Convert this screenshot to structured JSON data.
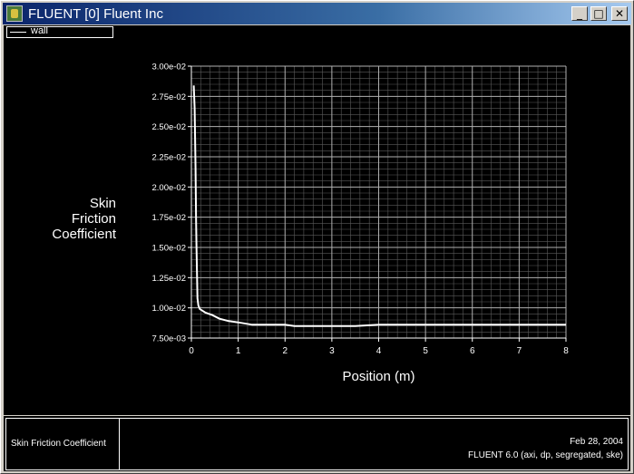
{
  "window": {
    "title": "FLUENT [0] Fluent Inc",
    "buttons": {
      "minimize": "_",
      "maximize": "□",
      "close": "✕"
    }
  },
  "legend": {
    "label": "wall"
  },
  "footer": {
    "plot_name": "Skin Friction Coefficient",
    "date": "Feb 28, 2004",
    "version": "FLUENT 6.0 (axi, dp, segregated, ske)"
  },
  "colors": {
    "background": "#000000",
    "foreground": "#ffffff",
    "grid": "#b0b0b0"
  },
  "chart_data": {
    "type": "line",
    "xlabel": "Position (m)",
    "ylabel": [
      "Skin",
      "Friction",
      "Coefficient"
    ],
    "xlim": [
      0,
      8
    ],
    "ylim": [
      0.0075,
      0.03
    ],
    "xticks": [
      "0",
      "1",
      "2",
      "3",
      "4",
      "5",
      "6",
      "7",
      "8"
    ],
    "yticks": [
      "7.50e-03",
      "1.00e-02",
      "1.25e-02",
      "1.50e-02",
      "1.75e-02",
      "2.00e-02",
      "2.25e-02",
      "2.50e-02",
      "2.75e-02",
      "3.00e-02"
    ],
    "grid": true,
    "legend_position": "top-left",
    "series": [
      {
        "name": "wall",
        "x": [
          0.05,
          0.07,
          0.08,
          0.09,
          0.1,
          0.11,
          0.12,
          0.13,
          0.15,
          0.18,
          0.22,
          0.3,
          0.45,
          0.6,
          0.8,
          1.0,
          1.3,
          1.6,
          2.0,
          2.2,
          2.5,
          3.0,
          3.5,
          4.0,
          5.0,
          6.0,
          7.0,
          8.0
        ],
        "y": [
          0.0284,
          0.0265,
          0.024,
          0.0215,
          0.0172,
          0.0148,
          0.0128,
          0.0108,
          0.0102,
          0.0099,
          0.0098,
          0.0096,
          0.0094,
          0.0091,
          0.0089,
          0.0088,
          0.0086,
          0.0086,
          0.0086,
          0.0085,
          0.0085,
          0.0085,
          0.0085,
          0.0086,
          0.0086,
          0.0086,
          0.0086,
          0.0086
        ]
      }
    ]
  }
}
